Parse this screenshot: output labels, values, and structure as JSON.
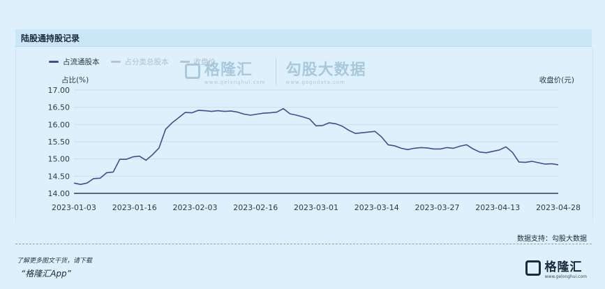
{
  "card": {
    "title": "陆股通持股记录"
  },
  "legend": [
    {
      "label": "占流通股本",
      "color": "#3d4f8f",
      "active": true
    },
    {
      "label": "占分类总股本",
      "color": "#b7c4ce",
      "active": false
    },
    {
      "label": "收盘价",
      "color": "#b7c4ce",
      "active": false
    }
  ],
  "axes": {
    "left_title": "占比(%)",
    "right_title": "收盘价(元)"
  },
  "watermark": {
    "brand1": "格隆汇",
    "brand1_url": "www.gelonghui.com",
    "brand2": "勾股大数据",
    "brand2_url": "www.gogudata.com"
  },
  "source": "数据支持：勾股大数据",
  "footer": {
    "note": "了解更多图文干货，请下载",
    "app": "“格隆汇App”"
  },
  "brand": {
    "name": "格隆汇",
    "url": "www.gelonghui.com"
  },
  "chart_data": {
    "type": "line",
    "ylim": [
      14.0,
      17.0
    ],
    "yticks": [
      "17.00",
      "16.50",
      "16.00",
      "15.50",
      "15.00",
      "14.50",
      "14.00"
    ],
    "xticks": [
      "2023-01-03",
      "2023-01-16",
      "2023-02-03",
      "2023-02-16",
      "2023-03-01",
      "2023-03-14",
      "2023-03-27",
      "2023-04-13",
      "2023-04-28"
    ],
    "grid": true,
    "series": [
      {
        "name": "占流通股本",
        "color": "#3d4f8f",
        "values": [
          14.3,
          14.26,
          14.3,
          14.43,
          14.44,
          14.6,
          14.62,
          14.99,
          14.99,
          15.06,
          15.08,
          14.96,
          15.12,
          15.32,
          15.86,
          16.05,
          16.2,
          16.35,
          16.34,
          16.41,
          16.4,
          16.38,
          16.4,
          16.38,
          16.39,
          16.36,
          16.3,
          16.27,
          16.3,
          16.33,
          16.34,
          16.36,
          16.46,
          16.31,
          16.27,
          16.22,
          16.16,
          15.96,
          15.97,
          16.05,
          16.02,
          15.95,
          15.83,
          15.74,
          15.76,
          15.78,
          15.8,
          15.64,
          15.41,
          15.38,
          15.31,
          15.27,
          15.31,
          15.33,
          15.32,
          15.29,
          15.29,
          15.33,
          15.31,
          15.37,
          15.41,
          15.29,
          15.2,
          15.18,
          15.22,
          15.26,
          15.35,
          15.19,
          14.91,
          14.9,
          14.93,
          14.89,
          14.85,
          14.86,
          14.83
        ]
      }
    ]
  }
}
